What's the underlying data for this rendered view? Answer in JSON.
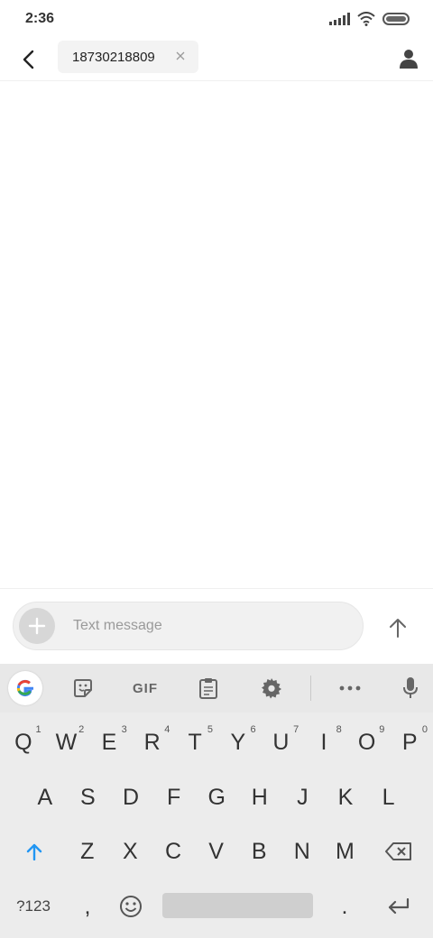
{
  "status_bar": {
    "time": "2:36"
  },
  "header": {
    "recipient": "18730218809"
  },
  "compose": {
    "placeholder": "Text message"
  },
  "keyboard": {
    "toolbar": {
      "gif_label": "GIF"
    },
    "row1": [
      {
        "label": "Q",
        "hint": "1"
      },
      {
        "label": "W",
        "hint": "2"
      },
      {
        "label": "E",
        "hint": "3"
      },
      {
        "label": "R",
        "hint": "4"
      },
      {
        "label": "T",
        "hint": "5"
      },
      {
        "label": "Y",
        "hint": "6"
      },
      {
        "label": "U",
        "hint": "7"
      },
      {
        "label": "I",
        "hint": "8"
      },
      {
        "label": "O",
        "hint": "9"
      },
      {
        "label": "P",
        "hint": "0"
      }
    ],
    "row2": [
      "A",
      "S",
      "D",
      "F",
      "G",
      "H",
      "J",
      "K",
      "L"
    ],
    "row3": [
      "Z",
      "X",
      "C",
      "V",
      "B",
      "N",
      "M"
    ],
    "symbols_label": "?123",
    "comma_label": ",",
    "period_label": "."
  },
  "colors": {
    "accent": "#2196f3",
    "keyboard_bg": "#ececec"
  },
  "icons": {
    "back": "arrow-left-icon",
    "chip_close": "close-icon",
    "contact": "person-icon",
    "attach": "plus-icon",
    "send": "arrow-up-icon",
    "shift": "shift-arrow-icon",
    "backspace": "backspace-icon",
    "enter": "enter-icon",
    "emoji": "smiley-icon",
    "mic": "microphone-icon",
    "settings": "gear-icon",
    "clipboard": "clipboard-icon",
    "sticker": "sticker-icon",
    "more": "more-dots-icon",
    "google": "google-g-icon"
  }
}
